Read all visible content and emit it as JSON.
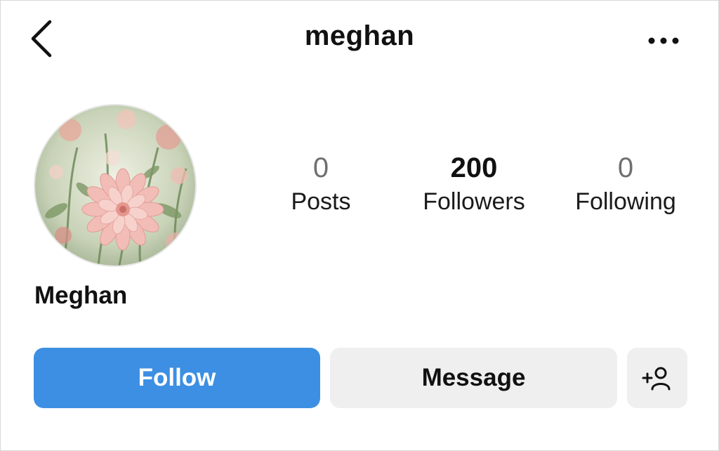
{
  "header": {
    "username": "meghan",
    "back_icon": "chevron-left-icon",
    "more_icon": "more-horizontal-icon"
  },
  "profile": {
    "display_name": "Meghan",
    "avatar": "flower-photo-avatar"
  },
  "stats": [
    {
      "count": "0",
      "label": "Posts"
    },
    {
      "count": "200",
      "label": "Followers"
    },
    {
      "count": "0",
      "label": "Following"
    }
  ],
  "actions": {
    "follow_label": "Follow",
    "message_label": "Message",
    "suggest_icon": "add-person-icon"
  },
  "colors": {
    "follow_button": "#3d8fe3",
    "secondary_button": "#efefef",
    "text": "#111111",
    "muted_text": "#6f6f6f"
  }
}
